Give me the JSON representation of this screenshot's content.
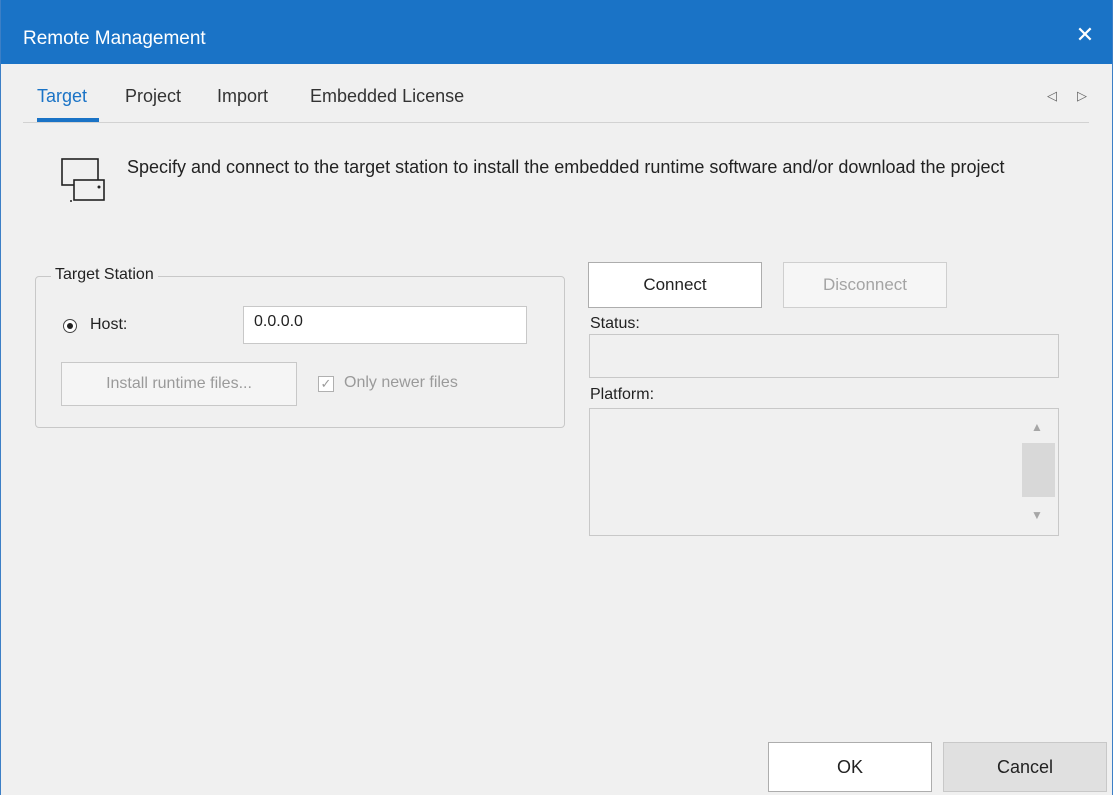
{
  "window": {
    "title": "Remote Management",
    "close_symbol": "✕",
    "accent_color": "#1a73c6"
  },
  "tabs": {
    "items": [
      {
        "label": "Target",
        "active": true
      },
      {
        "label": "Project",
        "active": false
      },
      {
        "label": "Import",
        "active": false
      },
      {
        "label": "Embedded License",
        "active": false
      }
    ],
    "scroll_left_symbol": "◁",
    "scroll_right_symbol": "▷"
  },
  "description": {
    "icon": "target-station-icon",
    "text": "Specify and connect to the target station to install the embedded runtime software and/or download the project"
  },
  "target_station": {
    "legend": "Target Station",
    "host_label": "Host:",
    "host_selected": true,
    "host_value": "0.0.0.0",
    "install_button": "Install runtime files...",
    "only_newer_label": "Only newer files",
    "only_newer_checked": true,
    "check_symbol": "✓"
  },
  "connection": {
    "connect_label": "Connect",
    "disconnect_label": "Disconnect",
    "status_label": "Status:",
    "status_value": "",
    "platform_label": "Platform:",
    "platform_value": "",
    "scroll_up_symbol": "▲",
    "scroll_down_symbol": "▼"
  },
  "footer": {
    "ok_label": "OK",
    "cancel_label": "Cancel"
  }
}
